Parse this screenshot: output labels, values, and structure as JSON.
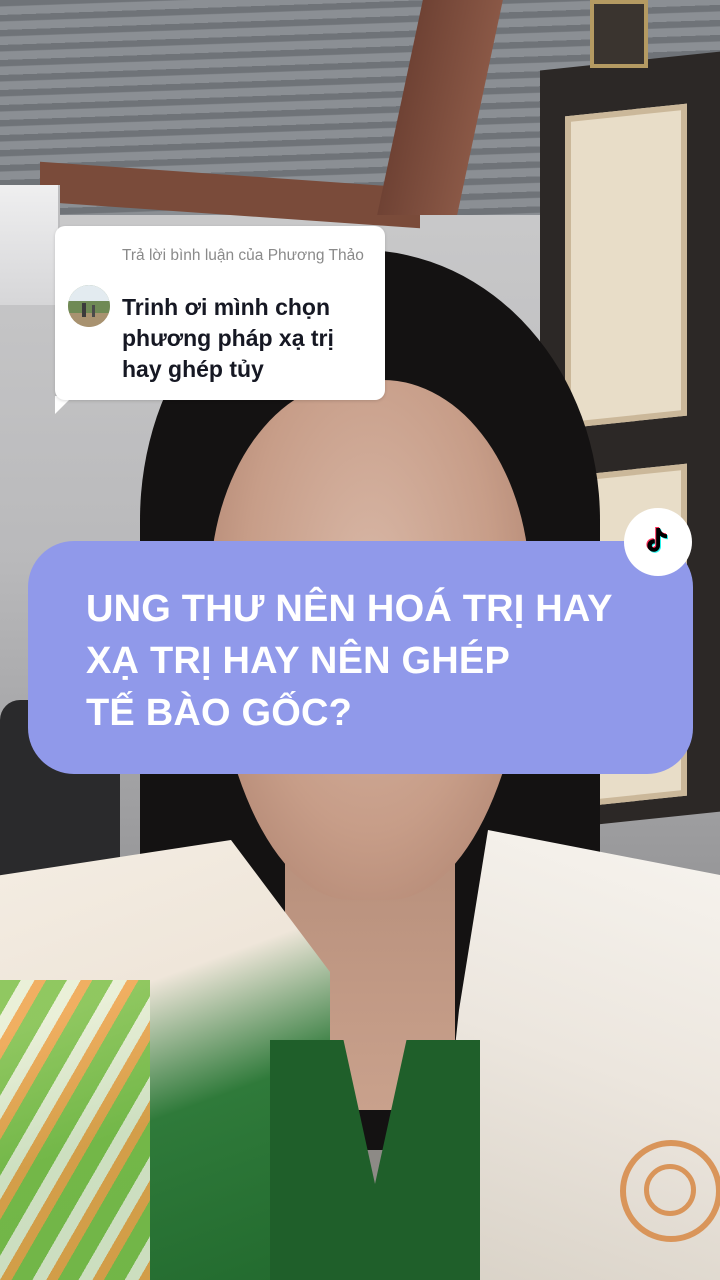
{
  "reply": {
    "header": "Trả lời bình luận của Phương Thảo",
    "comment": "Trinh ơi mình chọn phương pháp xạ trị hay ghép tủy"
  },
  "caption": {
    "text": "UNG THƯ NÊN HOÁ TRỊ HAY\nXẠ TRỊ HAY NÊN GHÉP\nTẾ BÀO GỐC?"
  },
  "colors": {
    "caption_background": "#9099ea",
    "caption_text": "#ffffff",
    "reply_background": "#ffffff",
    "reply_header_text": "#8a8a8a",
    "reply_comment_text": "#161823"
  },
  "icons": {
    "logo": "tiktok-logo-icon",
    "avatar": "commenter-avatar"
  }
}
